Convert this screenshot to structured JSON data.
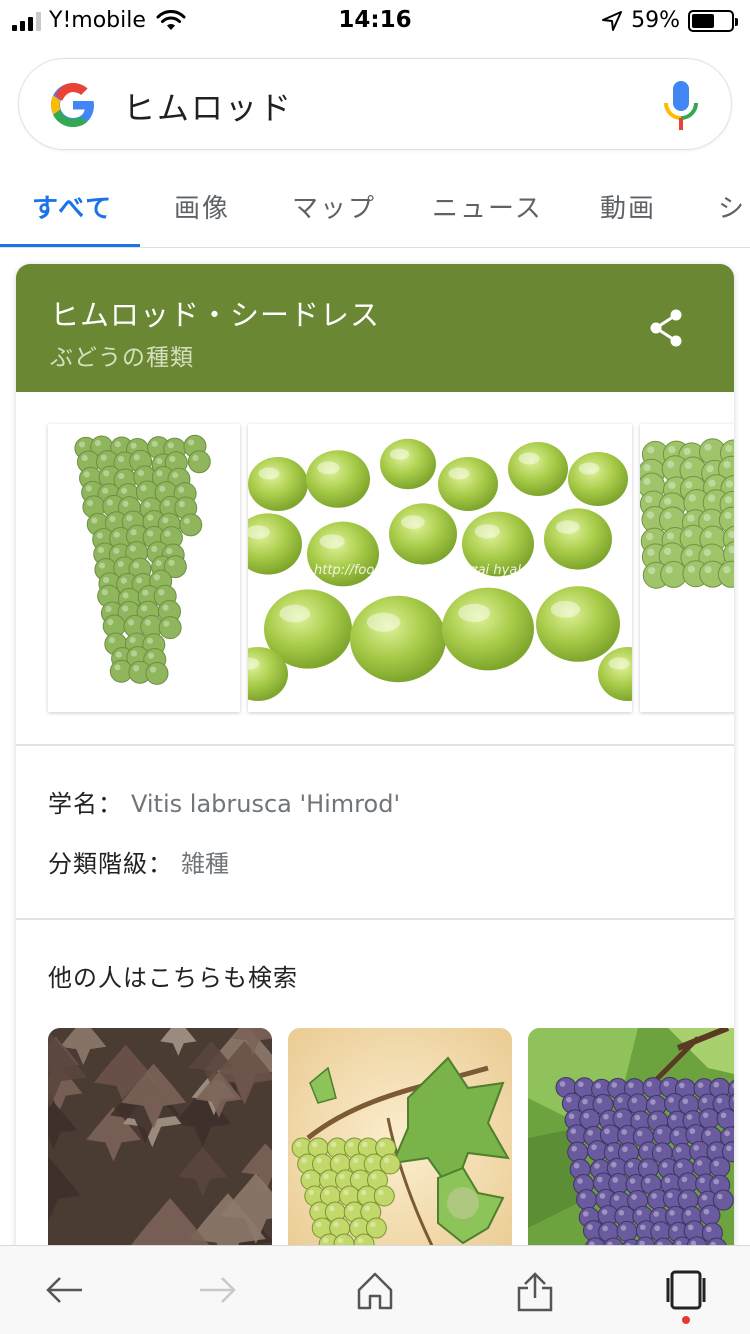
{
  "status_bar": {
    "carrier": "Y!mobile",
    "time": "14:16",
    "battery_percent": "59%",
    "battery_level": 0.59,
    "icons": [
      "signal-icon",
      "wifi-icon",
      "location-arrow-icon",
      "battery-icon"
    ]
  },
  "search": {
    "query": "ヒムロッド",
    "icons": [
      "google-logo-icon",
      "microphone-icon"
    ]
  },
  "tabs": [
    {
      "label": "すべて",
      "active": true
    },
    {
      "label": "画像",
      "active": false
    },
    {
      "label": "マップ",
      "active": false
    },
    {
      "label": "ニュース",
      "active": false
    },
    {
      "label": "動画",
      "active": false
    },
    {
      "label": "シ",
      "active": false
    }
  ],
  "knowledge_panel": {
    "title": "ヒムロッド・シードレス",
    "subtitle": "ぶどうの種類",
    "header_color": "#6a8734",
    "share_icon": "share-icon",
    "images": [
      "grape-cluster-image",
      "green-grapes-closeup-image",
      "grape-cluster-image-partial"
    ],
    "watermark": "http://foodslink.jp/syokuzai hyakka/",
    "facts": [
      {
        "label": "学名：",
        "value": "Vitis labrusca 'Himrod'"
      },
      {
        "label": "分類階級：",
        "value": "雑種"
      }
    ],
    "related_title": "他の人はこちらも検索",
    "related_images": [
      "dark-grape-leaves-image",
      "botanical-grape-illustration-image",
      "purple-grapes-vine-image"
    ]
  },
  "toolbar": {
    "icons": [
      "back-arrow-icon",
      "forward-arrow-icon",
      "home-icon",
      "share-upload-icon",
      "tabs-icon"
    ]
  }
}
